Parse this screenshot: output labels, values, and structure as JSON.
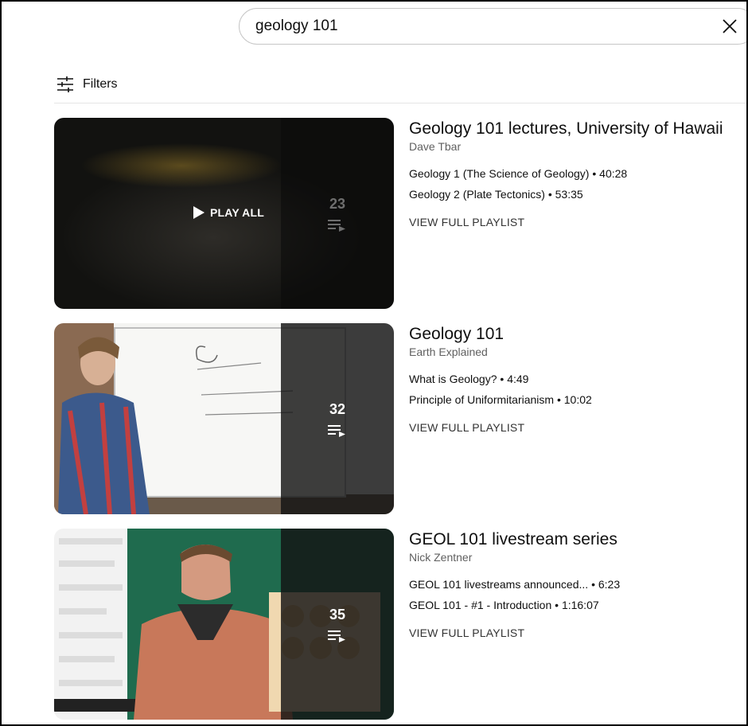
{
  "search": {
    "query": "geology 101"
  },
  "filters": {
    "label": "Filters"
  },
  "playlists": [
    {
      "title": "Geology 101 lectures, University of Hawaii",
      "channel": "Dave Tbar",
      "count": "23",
      "play_all_label": "PLAY ALL",
      "videos": [
        {
          "name": "Geology 1 (The Science of Geology)",
          "duration": "40:28"
        },
        {
          "name": "Geology 2 (Plate Tectonics)",
          "duration": "53:35"
        }
      ],
      "view_full_label": "VIEW FULL PLAYLIST"
    },
    {
      "title": "Geology 101",
      "channel": "Earth Explained",
      "count": "32",
      "videos": [
        {
          "name": "What is Geology?",
          "duration": "4:49"
        },
        {
          "name": "Principle of Uniformitarianism",
          "duration": "10:02"
        }
      ],
      "view_full_label": "VIEW FULL PLAYLIST"
    },
    {
      "title": "GEOL 101 livestream series",
      "channel": "Nick Zentner",
      "count": "35",
      "videos": [
        {
          "name": "GEOL 101 livestreams announced...",
          "duration": "6:23"
        },
        {
          "name": "GEOL 101 - #1 - Introduction",
          "duration": "1:16:07"
        }
      ],
      "view_full_label": "VIEW FULL PLAYLIST"
    }
  ],
  "separator": "•",
  "colors": {
    "text": "#0f0f0f",
    "secondary": "#606060",
    "border": "#c6c6c6"
  }
}
